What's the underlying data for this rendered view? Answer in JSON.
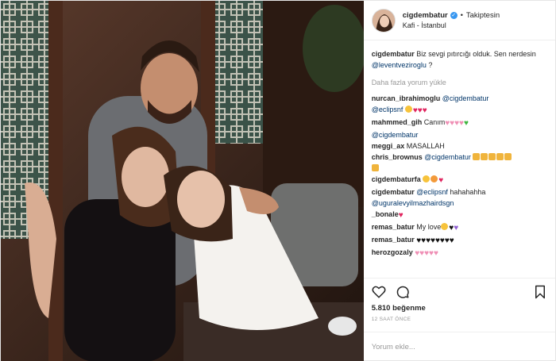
{
  "header": {
    "username": "cigdembatur",
    "verified_icon": "verified-badge-icon",
    "separator": "•",
    "follow_status": "Takiptesin",
    "location": "Kafi - İstanbul"
  },
  "caption": {
    "username": "cigdembatur",
    "text": "Biz sevgi pıtırcığı olduk. Sen nerdesin",
    "mention": "@leventveziroglu",
    "suffix": " ?"
  },
  "load_more": "Daha fazla yorum yükle",
  "comments": [
    {
      "user": "nurcan_ibrahimoglu",
      "mention": "@cigdembatur",
      "text": "",
      "line2_mention": "@eclipsnf",
      "emojis": [
        "smile",
        "heart-red",
        "heart-red",
        "heart-red"
      ]
    },
    {
      "user": "mahmmed_gih",
      "text": "Canım",
      "emojis_inline": [
        "heart-pink",
        "heart-pink",
        "heart-pink",
        "heart-pink",
        "heart-green"
      ],
      "line2_mention": "@cigdembatur"
    },
    {
      "user": "meggi_ax",
      "text": "MASALLAH"
    },
    {
      "user": "chris_brownus",
      "mention": "@cigdembatur",
      "emojis_inline": [
        "clap",
        "clap",
        "clap",
        "clap",
        "clap"
      ],
      "line2_emojis": [
        "clap"
      ]
    },
    {
      "user": "cigdembaturfa",
      "emojis_inline": [
        "smile",
        "smile",
        "heart-red"
      ]
    },
    {
      "user": "cigdembatur",
      "mention": "@eclipsnf",
      "text": "hahahahha",
      "line2_mention": "@uguralevyilmazhairdsgn"
    },
    {
      "user": "_bonale",
      "emojis_inline": [
        "heart-red"
      ]
    },
    {
      "user": "remas_batur",
      "text": "My love",
      "emojis_inline": [
        "smile",
        "heart-black",
        "heart-purple"
      ]
    },
    {
      "user": "remas_batur",
      "emojis_inline": [
        "heart-black",
        "heart-black",
        "heart-black",
        "heart-black",
        "heart-black",
        "heart-black",
        "heart-black",
        "heart-black"
      ]
    },
    {
      "user": "herozgozaly",
      "emojis_inline": [
        "heart-pink",
        "heart-pink",
        "heart-pink",
        "heart-pink",
        "heart-pink"
      ]
    }
  ],
  "actions": {
    "like_icon": "heart-outline-icon",
    "comment_icon": "comment-bubble-icon",
    "save_icon": "bookmark-icon",
    "likes": "5.810 beğenme",
    "time_ago": "12 SAAT ÖNCE"
  },
  "add_comment": {
    "placeholder": "Yorum ekle..."
  },
  "colors": {
    "accent_blue": "#3897f0",
    "mention_blue": "#003569",
    "muted": "#999999",
    "heart_red": "#e0245e"
  }
}
